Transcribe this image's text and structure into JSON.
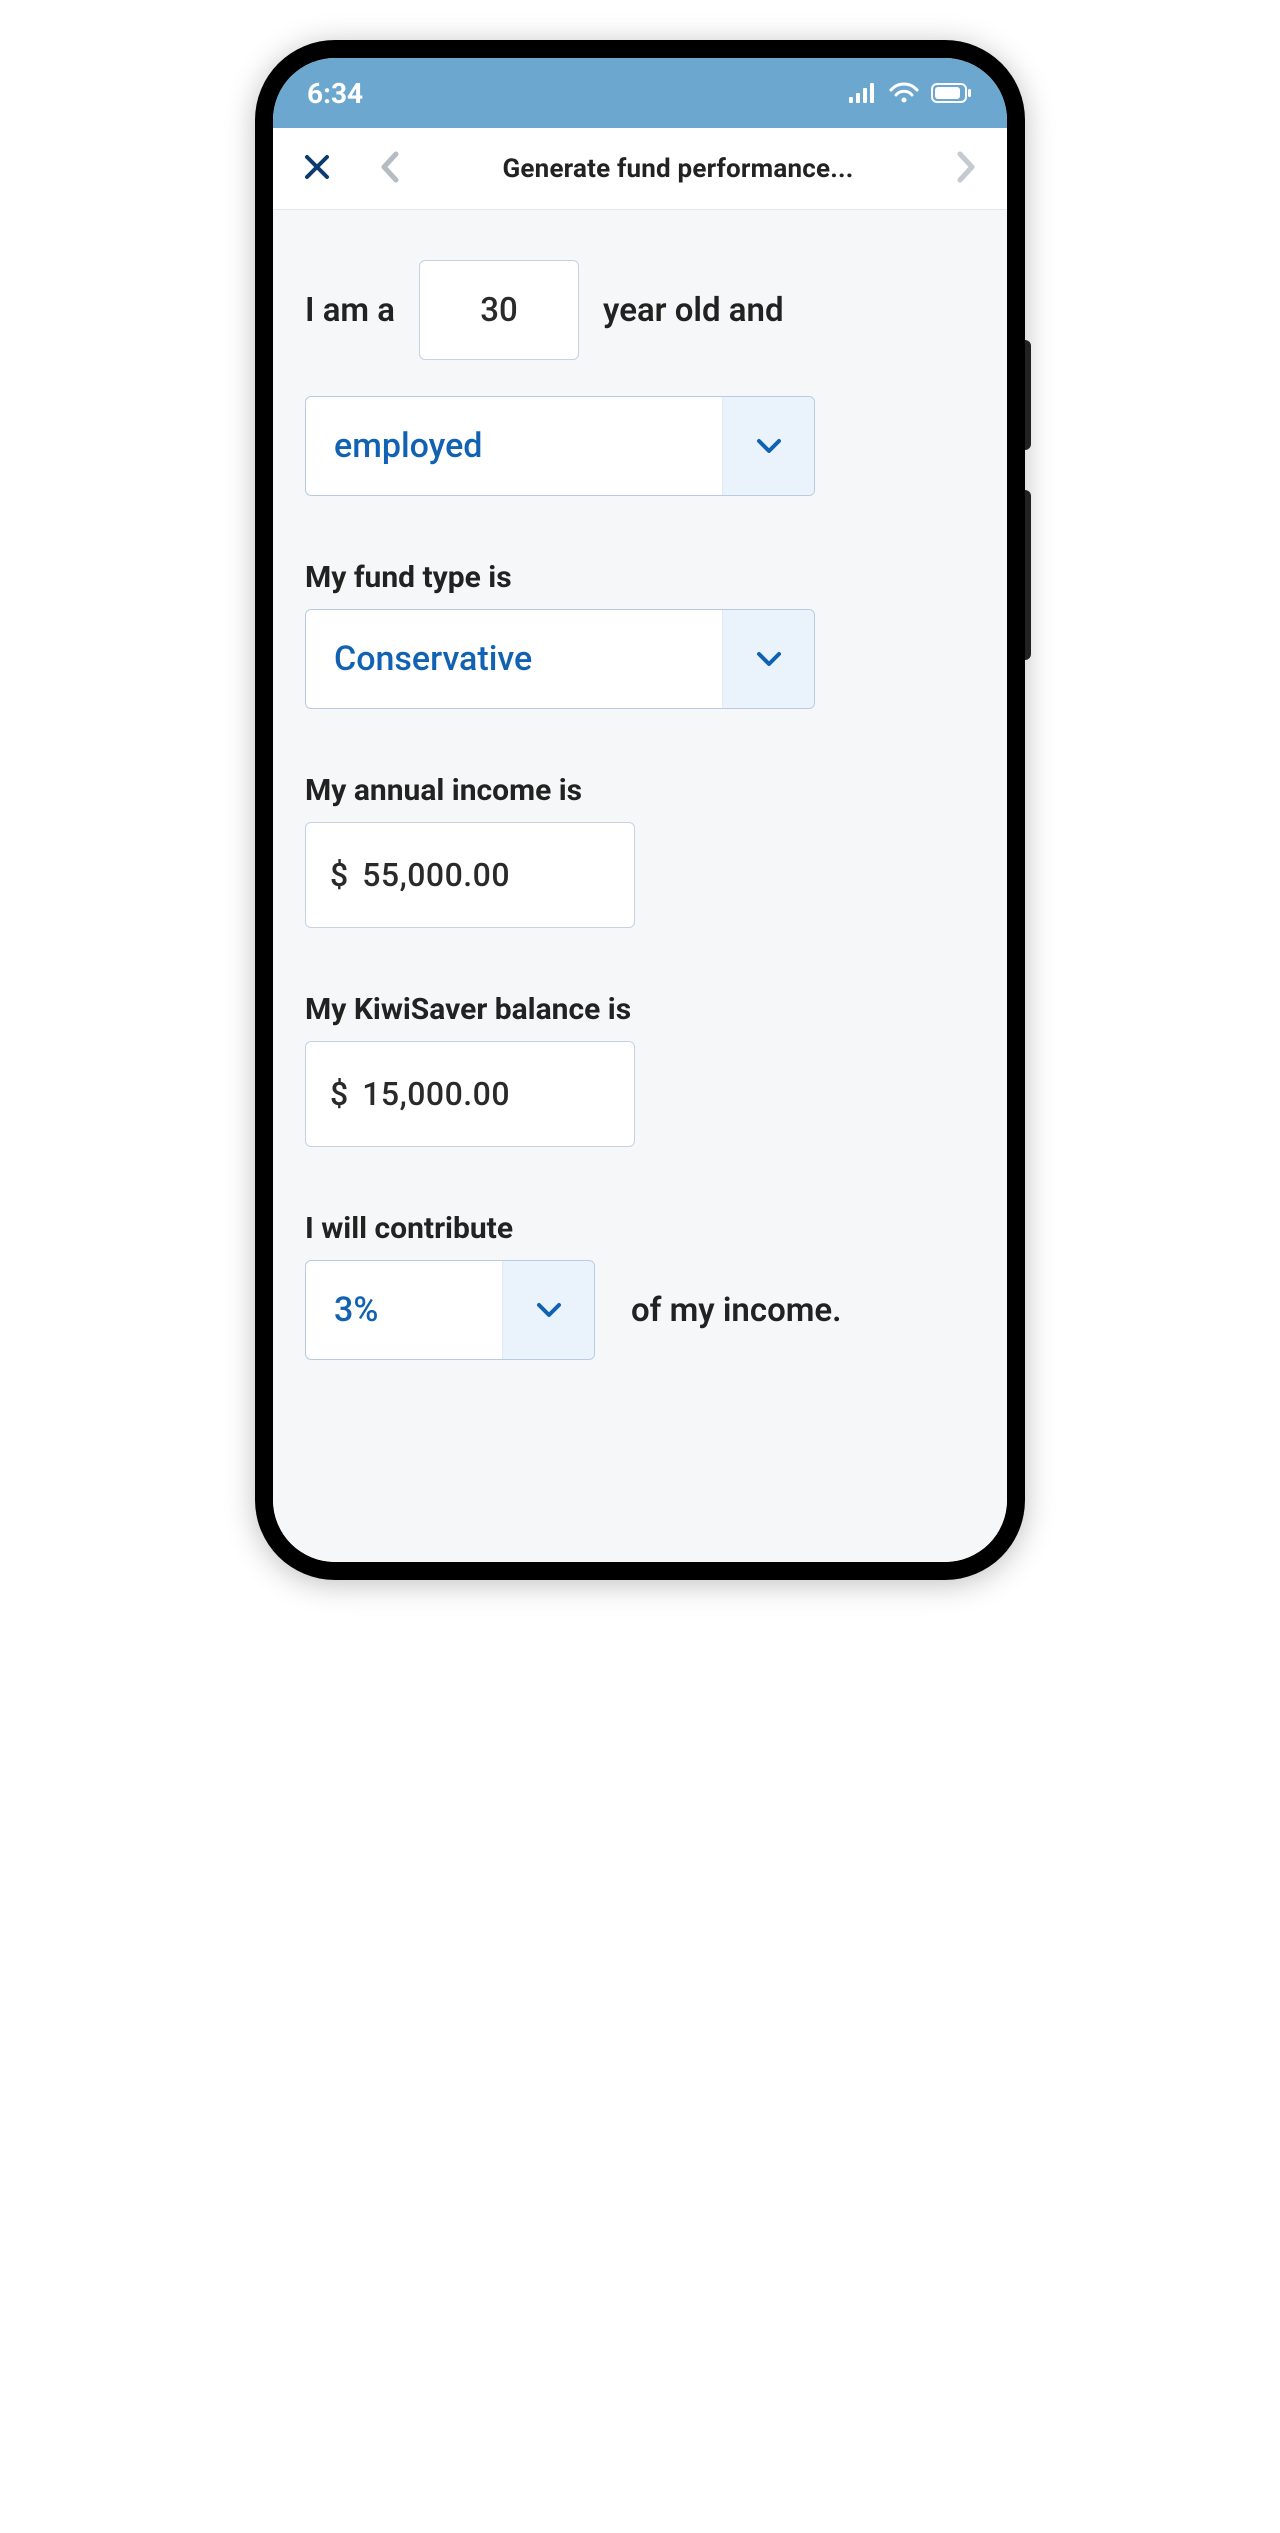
{
  "status": {
    "time": "6:34"
  },
  "nav": {
    "title": "Generate fund performance..."
  },
  "form": {
    "age_prefix": "I am a",
    "age_value": "30",
    "age_suffix": "year old and",
    "employment_value": "employed",
    "fund_label": "My fund type is",
    "fund_value": "Conservative",
    "income_label": "My annual income is",
    "income_currency": "$",
    "income_value": "55,000.00",
    "balance_label": "My KiwiSaver balance is",
    "balance_currency": "$",
    "balance_value": "15,000.00",
    "contribute_label": "I will contribute",
    "contribute_value": "3%",
    "contribute_suffix": "of my income."
  }
}
